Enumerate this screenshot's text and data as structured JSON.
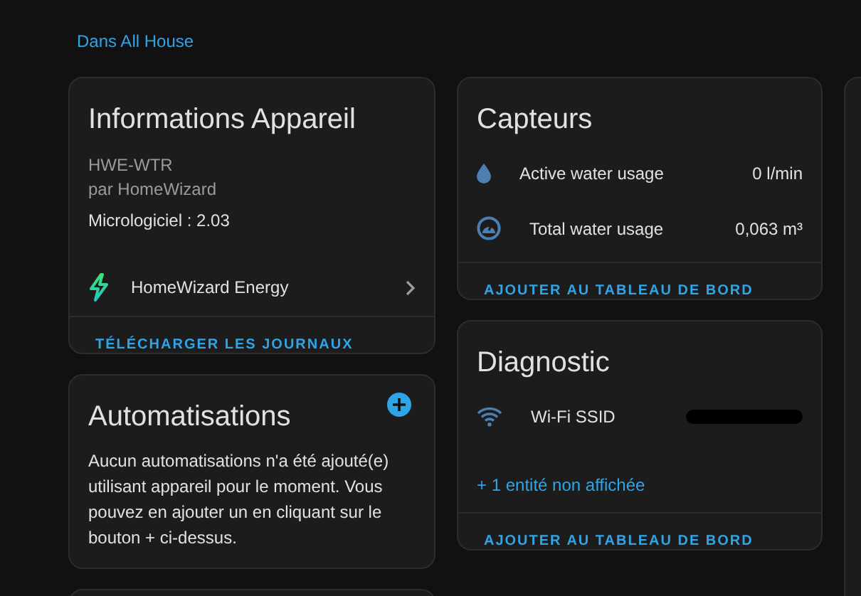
{
  "breadcrumb": "Dans All House",
  "device_info": {
    "title": "Informations Appareil",
    "model": "HWE-WTR",
    "manufacturer": "par HomeWizard",
    "firmware": "Micrologiciel : 2.03",
    "integration": "HomeWizard Energy",
    "action": "TÉLÉCHARGER LES JOURNAUX"
  },
  "automations": {
    "title": "Automatisations",
    "message": "Aucun automatisations n'a été ajouté(e) utilisant appareil pour le moment. Vous pouvez en ajouter un en cliquant sur le bouton + ci-dessus."
  },
  "sensors": {
    "title": "Capteurs",
    "rows": [
      {
        "kind": "drop",
        "name": "Active water usage",
        "value": "0 l/min"
      },
      {
        "kind": "gauge",
        "name": "Total water usage",
        "value": "0,063 m³"
      }
    ],
    "action": "AJOUTER AU TABLEAU DE BORD"
  },
  "diagnostic": {
    "title": "Diagnostic",
    "rows": [
      {
        "kind": "wifi",
        "name": "Wi-Fi SSID",
        "redacted": true
      }
    ],
    "hidden_link": "+ 1 entité non affichée",
    "action": "AJOUTER AU TABLEAU DE BORD"
  }
}
